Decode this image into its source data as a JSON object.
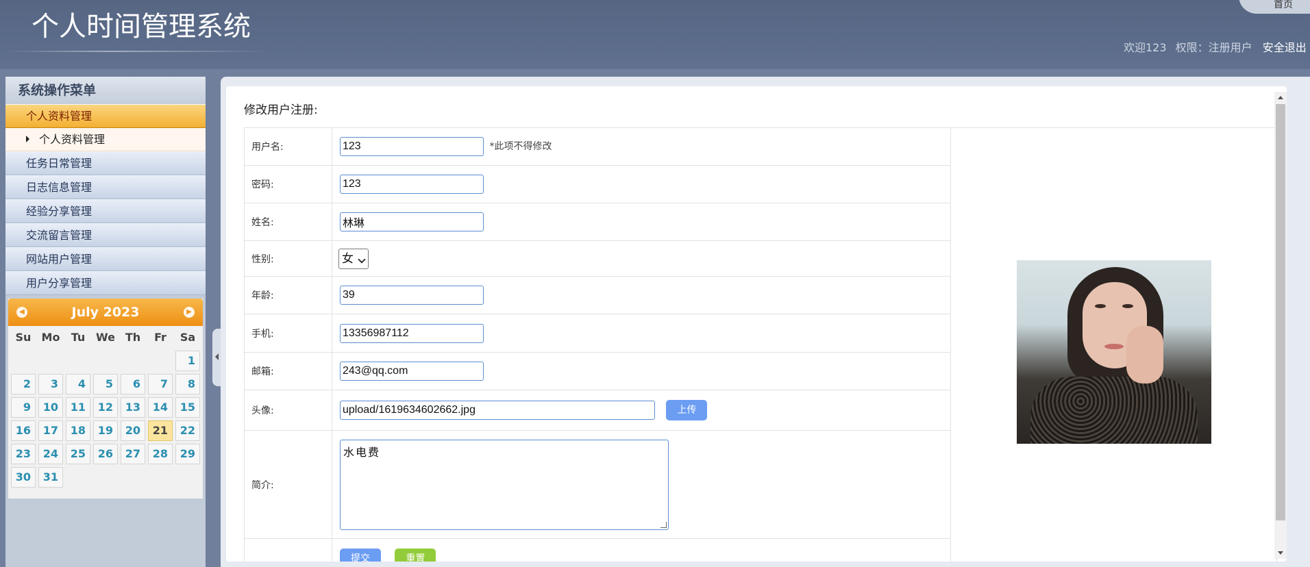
{
  "header": {
    "title": "个人时间管理系统",
    "home_tab": "首页",
    "welcome": "欢迎123",
    "permission": "权限：注册用户",
    "logout": "安全退出"
  },
  "sidebar": {
    "heading": "系统操作菜单",
    "active_category": "个人资料管理",
    "active_sub_item": "个人资料管理",
    "categories": [
      "任务日常管理",
      "日志信息管理",
      "经验分享管理",
      "交流留言管理",
      "网站用户管理",
      "用户分享管理"
    ]
  },
  "calendar": {
    "month_label": "July 2023",
    "weekdays": [
      "Su",
      "Mo",
      "Tu",
      "We",
      "Th",
      "Fr",
      "Sa"
    ],
    "first_weekday_index": 6,
    "days_in_month": 31,
    "today": 21
  },
  "form": {
    "title": "修改用户注册:",
    "fields": {
      "username": {
        "label": "用户名:",
        "value": "123",
        "hint": "*此项不得修改"
      },
      "password": {
        "label": "密码:",
        "value": "123"
      },
      "name": {
        "label": "姓名:",
        "value": "林琳"
      },
      "gender": {
        "label": "性别:",
        "value": "女"
      },
      "age": {
        "label": "年龄:",
        "value": "39"
      },
      "phone": {
        "label": "手机:",
        "value": "13356987112"
      },
      "email": {
        "label": "邮箱:",
        "value": "243@qq.com"
      },
      "avatar": {
        "label": "头像:",
        "value": "upload/1619634602662.jpg",
        "upload_button": "上传"
      },
      "intro": {
        "label": "简介:",
        "value": "水电费"
      }
    },
    "submit_label": "提交",
    "reset_label": "重置"
  },
  "colors": {
    "header_bg": "#5c6d8b",
    "accent_orange": "#f3b033",
    "button_blue": "#6b9df3",
    "button_green": "#93cc3a",
    "calendar_day_text": "#2a8fb0"
  }
}
